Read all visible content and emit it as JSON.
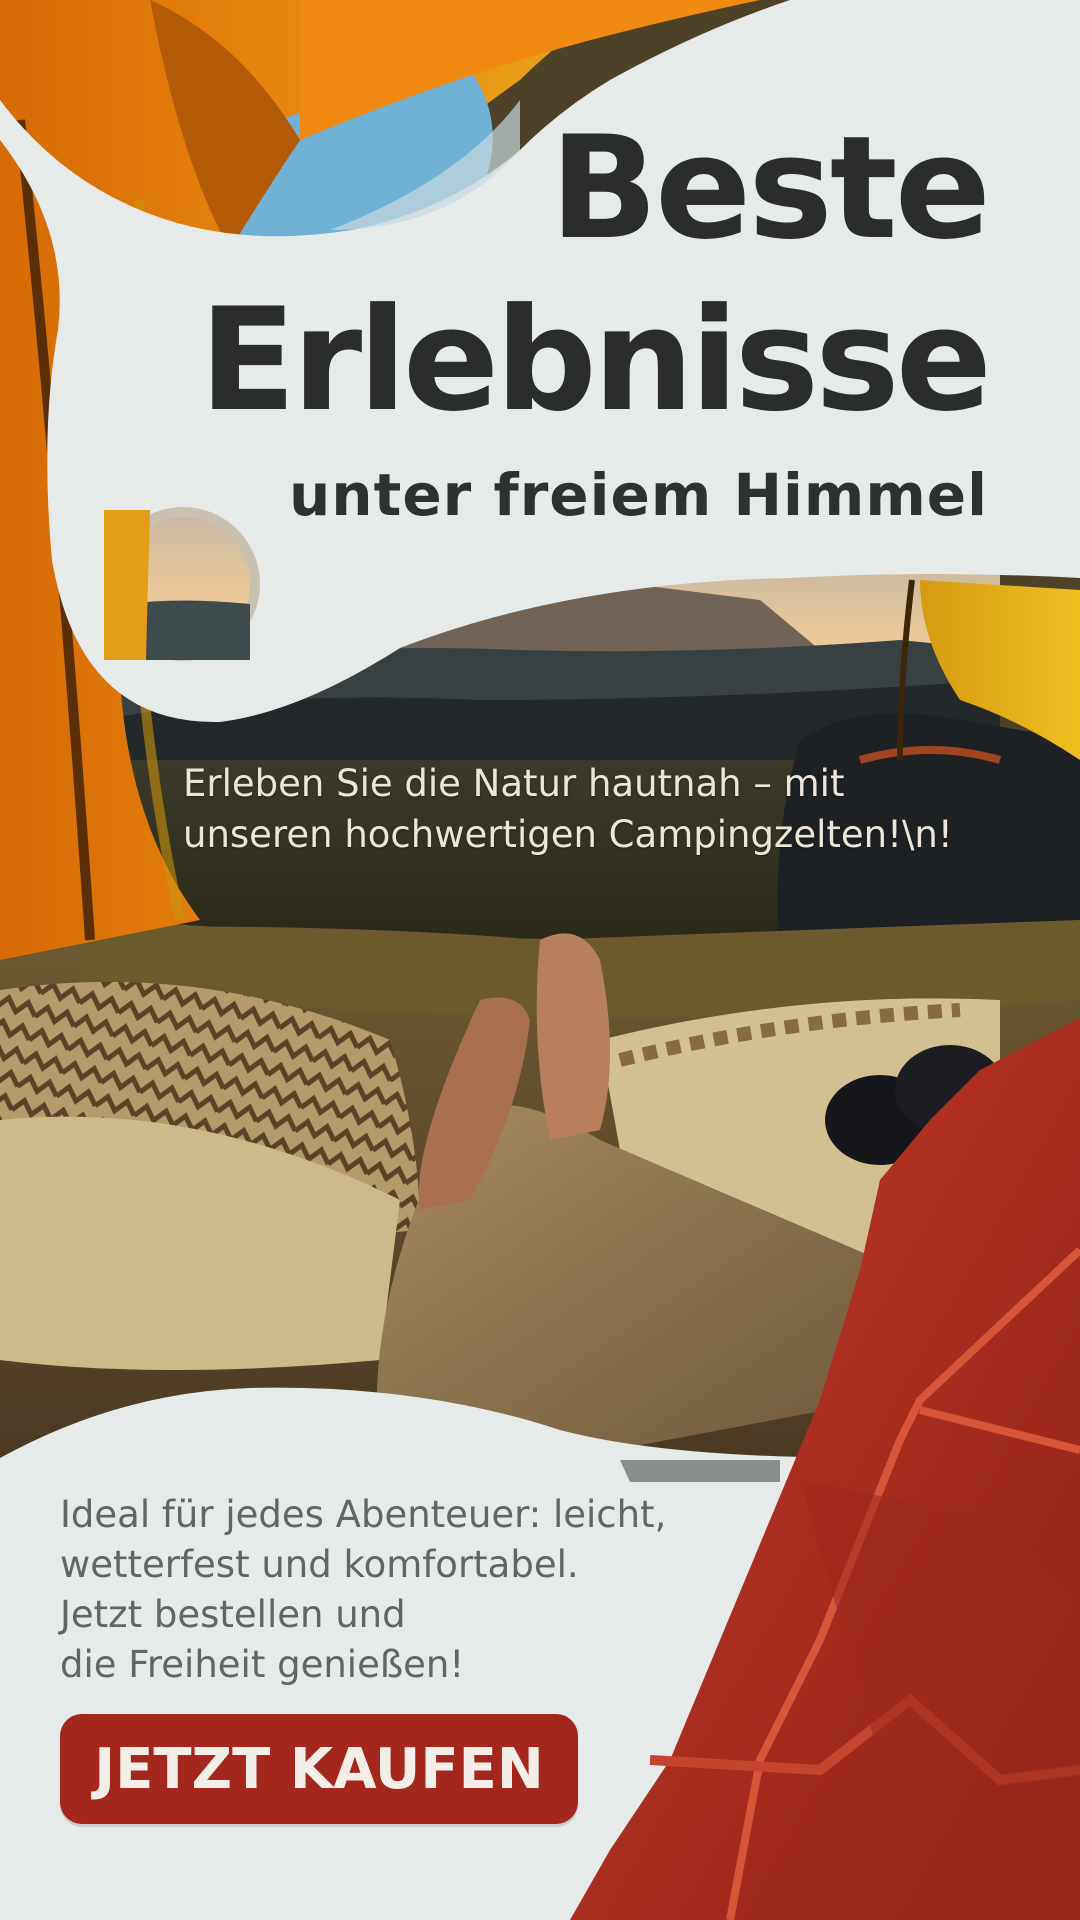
{
  "headline": {
    "line1": "Beste",
    "line2": "Erlebnisse",
    "sub": "unter freiem Himmel"
  },
  "tagline": {
    "line1": "Erleben Sie die Natur hautnah – mit",
    "line2": "unseren hochwertigen Campingzelten!\\n!"
  },
  "body": {
    "line1": "Ideal für jedes Abenteuer: leicht,",
    "line2": "wetterfest und komfortabel.",
    "line3": "Jetzt bestellen und",
    "line4": "die Freiheit genießen!"
  },
  "cta": {
    "label": "JETZT KAUFEN"
  },
  "colors": {
    "background": "#e6eae9",
    "headline": "#2b2d2b",
    "accent_red": "#a4271e",
    "tent_orange": "#e3860f",
    "tent_yellow": "#e7b21d",
    "body_text": "#616563"
  }
}
